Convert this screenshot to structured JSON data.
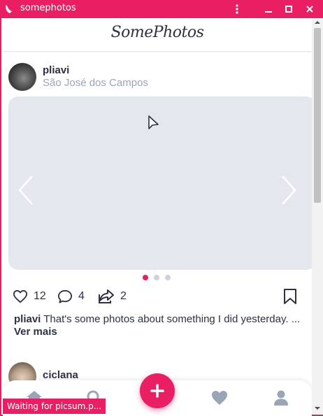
{
  "window": {
    "title": "somephotos"
  },
  "app": {
    "logo": "SomePhotos"
  },
  "post": {
    "username": "pliavi",
    "location": "São José dos Campos",
    "carousel": {
      "active_index": 0,
      "total": 3
    },
    "likes": "12",
    "comments": "4",
    "shares": "2",
    "caption_user": "pliavi",
    "caption_text": " That's some photos about something I did yesterday. ... ",
    "see_more": "Ver mais"
  },
  "post2": {
    "username": "ciclana"
  },
  "status": {
    "text": "Waiting for picsum.p..."
  },
  "colors": {
    "accent": "#e91e63",
    "text": "#2d3142",
    "muted": "#9aa5b8",
    "placeholder": "#e4e8ee"
  },
  "icons": [
    "app-icon",
    "menu-icon",
    "minimize-icon",
    "maximize-icon",
    "close-icon",
    "chevron-left-icon",
    "chevron-right-icon",
    "heart-icon",
    "comment-icon",
    "share-icon",
    "bookmark-icon",
    "home-icon",
    "search-icon",
    "plus-icon",
    "favorites-icon",
    "profile-icon"
  ]
}
